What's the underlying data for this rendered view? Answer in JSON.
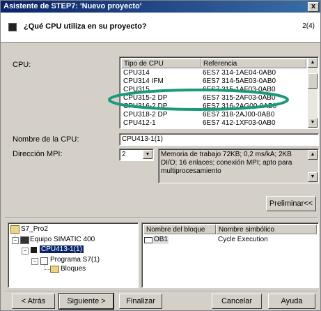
{
  "window": {
    "title": "Asistente de STEP7: 'Nuevo proyecto'",
    "close_glyph": "x"
  },
  "header": {
    "question": "¿Qué CPU utiliza en su proyecto?",
    "step": "2(4)"
  },
  "cpu_label": "CPU:",
  "cpu_table": {
    "headers": [
      "Tipo de CPU",
      "Referencia"
    ],
    "rows": [
      [
        "CPU314",
        "6ES7 314-1AE04-0AB0"
      ],
      [
        "CPU314 IFM",
        "6ES7 314-5AE03-0AB0"
      ],
      [
        "CPU315",
        "6ES7 315-1AF03-0AB0"
      ],
      [
        "CPU315-2 DP",
        "6ES7 315-2AF03-0AB0"
      ],
      [
        "CPU316-2 DP",
        "6ES7 316-2AG00-0AB0"
      ],
      [
        "CPU318-2 DP",
        "6ES7 318-2AJ00-0AB0"
      ],
      [
        "CPU412-1",
        "6ES7 412-1XF03-0AB0"
      ]
    ]
  },
  "cpu_name": {
    "label": "Nombre de la CPU:",
    "value": "CPU413-1(1)"
  },
  "mpi": {
    "label": "Dirección MPI:",
    "value": "2"
  },
  "description": "Memoria de trabajo 72KB; 0,2 ms/kA; 2KB DI/O; 16 enlaces; conexión MPI; apto para multiprocesamiento",
  "preview_button": "Preliminar<<",
  "tree": {
    "root": "S7_Pro2",
    "station": "Equipo SIMATIC 400",
    "cpu": "CPU413-1(1)",
    "program": "Programa S7(1)",
    "blocks": "Bloques"
  },
  "blocks_table": {
    "headers": [
      "Nombre del bloque",
      "Nombre simbólico"
    ],
    "rows": [
      [
        "OB1",
        "Cycle Execution"
      ]
    ]
  },
  "buttons": {
    "back": "< Atrás",
    "next": "Siguiente >",
    "finish": "Finalizar",
    "cancel": "Cancelar",
    "help": "Ayuda"
  },
  "annotation_color": "#1a9a7a"
}
